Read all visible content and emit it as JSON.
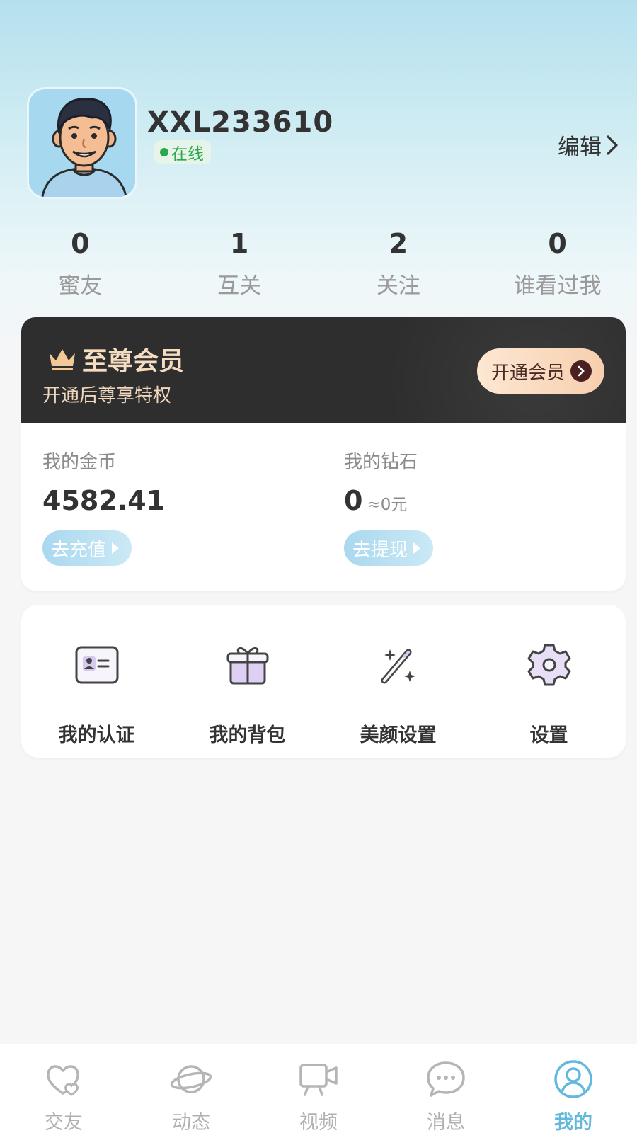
{
  "profile": {
    "username": "XXL233610",
    "status": "在线",
    "edit_label": "编辑"
  },
  "stats": [
    {
      "value": "0",
      "label": "蜜友"
    },
    {
      "value": "1",
      "label": "互关"
    },
    {
      "value": "2",
      "label": "关注"
    },
    {
      "value": "0",
      "label": "谁看过我"
    }
  ],
  "vip": {
    "title": "至尊会员",
    "subtitle": "开通后尊享特权",
    "button_label": "开通会员"
  },
  "wallet": {
    "coins": {
      "label": "我的金币",
      "value": "4582.41",
      "button_label": "去充值"
    },
    "diamonds": {
      "label": "我的钻石",
      "value": "0",
      "approx": "≈0元",
      "button_label": "去提现"
    }
  },
  "tools": [
    {
      "label": "我的认证",
      "icon": "id-card-icon"
    },
    {
      "label": "我的背包",
      "icon": "gift-icon"
    },
    {
      "label": "美颜设置",
      "icon": "magic-wand-icon"
    },
    {
      "label": "设置",
      "icon": "gear-icon"
    }
  ],
  "nav": [
    {
      "label": "交友",
      "icon": "hearts-icon"
    },
    {
      "label": "动态",
      "icon": "planet-icon"
    },
    {
      "label": "视频",
      "icon": "video-camera-icon"
    },
    {
      "label": "消息",
      "icon": "chat-bubble-icon"
    },
    {
      "label": "我的",
      "icon": "user-circle-icon"
    }
  ],
  "colors": {
    "accent": "#63b8de",
    "online": "#2aa84a",
    "vip_bg": "#2e2e2e",
    "vip_gold": "#f6dcc0"
  }
}
